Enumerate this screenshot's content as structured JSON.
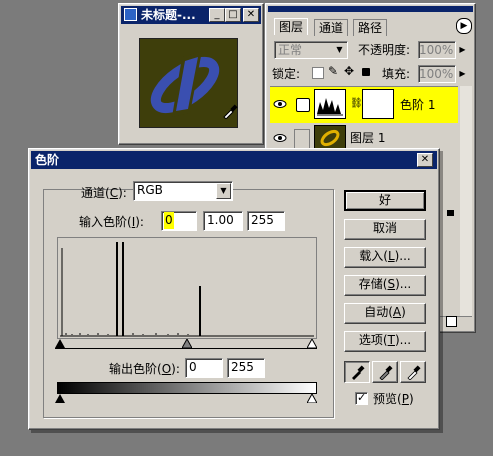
{
  "document_window": {
    "title": "未标题-...",
    "minimize": "_",
    "maximize": "□",
    "close": "✕"
  },
  "layers_panel": {
    "tabs": [
      "图层",
      "通道",
      "路径"
    ],
    "menu_arrow": "▶",
    "blend_mode": "正常",
    "opacity_label": "不透明度:",
    "opacity_value": "100%",
    "lock_label": "锁定:",
    "fill_label": "填充:",
    "fill_value": "100%",
    "layers": [
      {
        "name": "色阶 1"
      },
      {
        "name": "图层 1"
      }
    ]
  },
  "levels_dialog": {
    "title": "色阶",
    "close": "✕",
    "channel_label": "通道",
    "channel_key": "C",
    "channel_value": "RGB",
    "input_levels_label": "输入色阶",
    "input_key": "I",
    "input_values": [
      "0",
      "1.00",
      "255"
    ],
    "output_levels_label": "输出色阶",
    "output_key": "O",
    "output_values": [
      "0",
      "255"
    ],
    "buttons": {
      "ok": "好",
      "cancel": "取消",
      "load": "载入",
      "load_key": "L",
      "save": "存储",
      "save_key": "S",
      "auto": "自动",
      "auto_key": "A",
      "options": "选项",
      "options_key": "T"
    },
    "preview_label": "预览",
    "preview_key": "P",
    "preview_checked": "✓"
  }
}
